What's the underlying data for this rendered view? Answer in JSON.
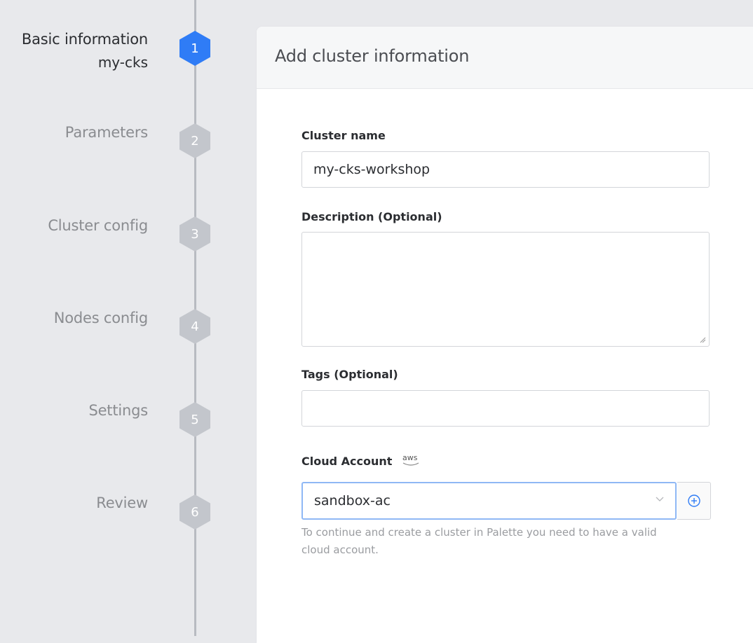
{
  "stepper": {
    "steps": [
      {
        "label": "Basic information",
        "sublabel": "my-cks",
        "number": "1",
        "active": true
      },
      {
        "label": "Parameters",
        "number": "2",
        "active": false
      },
      {
        "label": "Cluster config",
        "number": "3",
        "active": false
      },
      {
        "label": "Nodes config",
        "number": "4",
        "active": false
      },
      {
        "label": "Settings",
        "number": "5",
        "active": false
      },
      {
        "label": "Review",
        "number": "6",
        "active": false
      }
    ]
  },
  "card": {
    "title": "Add cluster information"
  },
  "form": {
    "cluster_name": {
      "label": "Cluster name",
      "value": "my-cks-workshop"
    },
    "description": {
      "label": "Description (Optional)",
      "value": ""
    },
    "tags": {
      "label": "Tags (Optional)",
      "value": ""
    },
    "cloud_account": {
      "label": "Cloud Account",
      "provider_badge": "aws",
      "selected": "sandbox-ac",
      "help": "To continue and create a cluster in Palette you need to have a valid cloud account."
    }
  },
  "colors": {
    "accent": "#2f7cf6",
    "inactive_step": "#c3c6cc",
    "select_focus": "#8fb8f5"
  }
}
